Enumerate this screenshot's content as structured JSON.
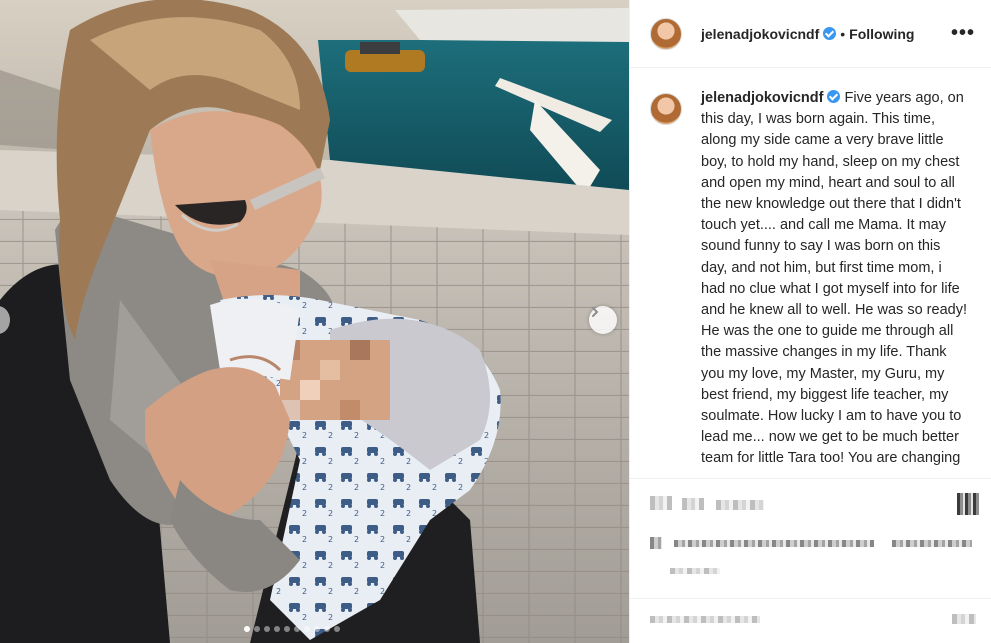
{
  "post": {
    "username": "jelenadjokovicndf",
    "verified": true,
    "separator": "•",
    "follow_state": "Following",
    "more_label": "•••",
    "caption": "Five years ago, on this day, I was born again. This time, along my side came a very brave little boy, to hold my hand, sleep on my chest and open my mind, heart and soul to all the new knowledge out there that I didn't touch yet.... and call me Mama. It may sound funny to say I was born on this day, and not him, but first time mom, i had no clue what I got myself into for life and he knew all to well. He was so ready! He was the one to guide me through all the massive changes in my life. Thank you my love, my Master, my Guru, my best friend, my biggest life teacher, my soulmate. How lucky I am to have you to lead me... now we get to be much better team for little Tara too! You are changing so fast and not getting"
  },
  "carousel": {
    "next_icon": "chevron-right-icon",
    "slide_count": 10,
    "active_slide": 1
  },
  "colors": {
    "verified_blue": "#3897f0",
    "border": "#efefef"
  }
}
